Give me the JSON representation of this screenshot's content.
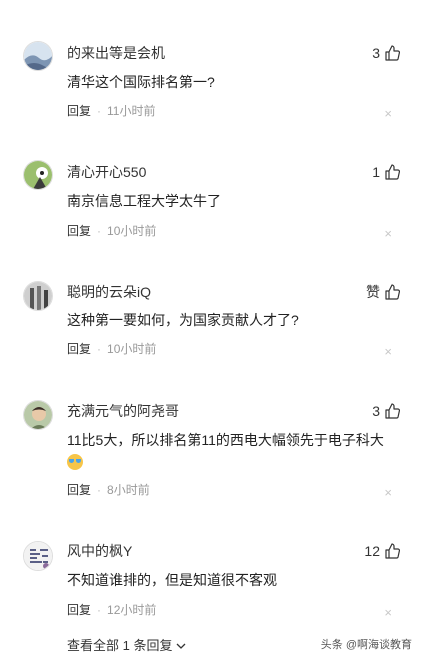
{
  "comments": [
    {
      "username": "的来出等是会机",
      "likes": "3",
      "text": "清华这个国际排名第一?",
      "reply_label": "回复",
      "dot": "·",
      "time": "11小时前",
      "close": "×"
    },
    {
      "username": "清心开心550",
      "likes": "1",
      "text": "南京信息工程大学太牛了",
      "reply_label": "回复",
      "dot": "·",
      "time": "10小时前",
      "close": "×"
    },
    {
      "username": "聪明的云朵iQ",
      "likes": "赞",
      "text": "这种第一要如何，为国家贡献人才了?",
      "reply_label": "回复",
      "dot": "·",
      "time": "10小时前",
      "close": "×"
    },
    {
      "username": "充满元气的阿尧哥",
      "likes": "3",
      "text": "11比5大，所以排名第11的西电大幅领先于电子科大",
      "reply_label": "回复",
      "dot": "·",
      "time": "8小时前",
      "close": "×"
    },
    {
      "username": "风中的枫Y",
      "likes": "12",
      "text": "不知道谁排的，但是知道很不客观",
      "reply_label": "回复",
      "dot": "·",
      "time": "12小时前",
      "close": "×"
    }
  ],
  "footer": {
    "view_all": "查看全部 1 条回复",
    "chevron": "⌄"
  },
  "watermark": "头条 @啊海谈教育",
  "colors": {
    "text": "#222222",
    "muted": "#999999",
    "close": "#c8c8c8"
  }
}
